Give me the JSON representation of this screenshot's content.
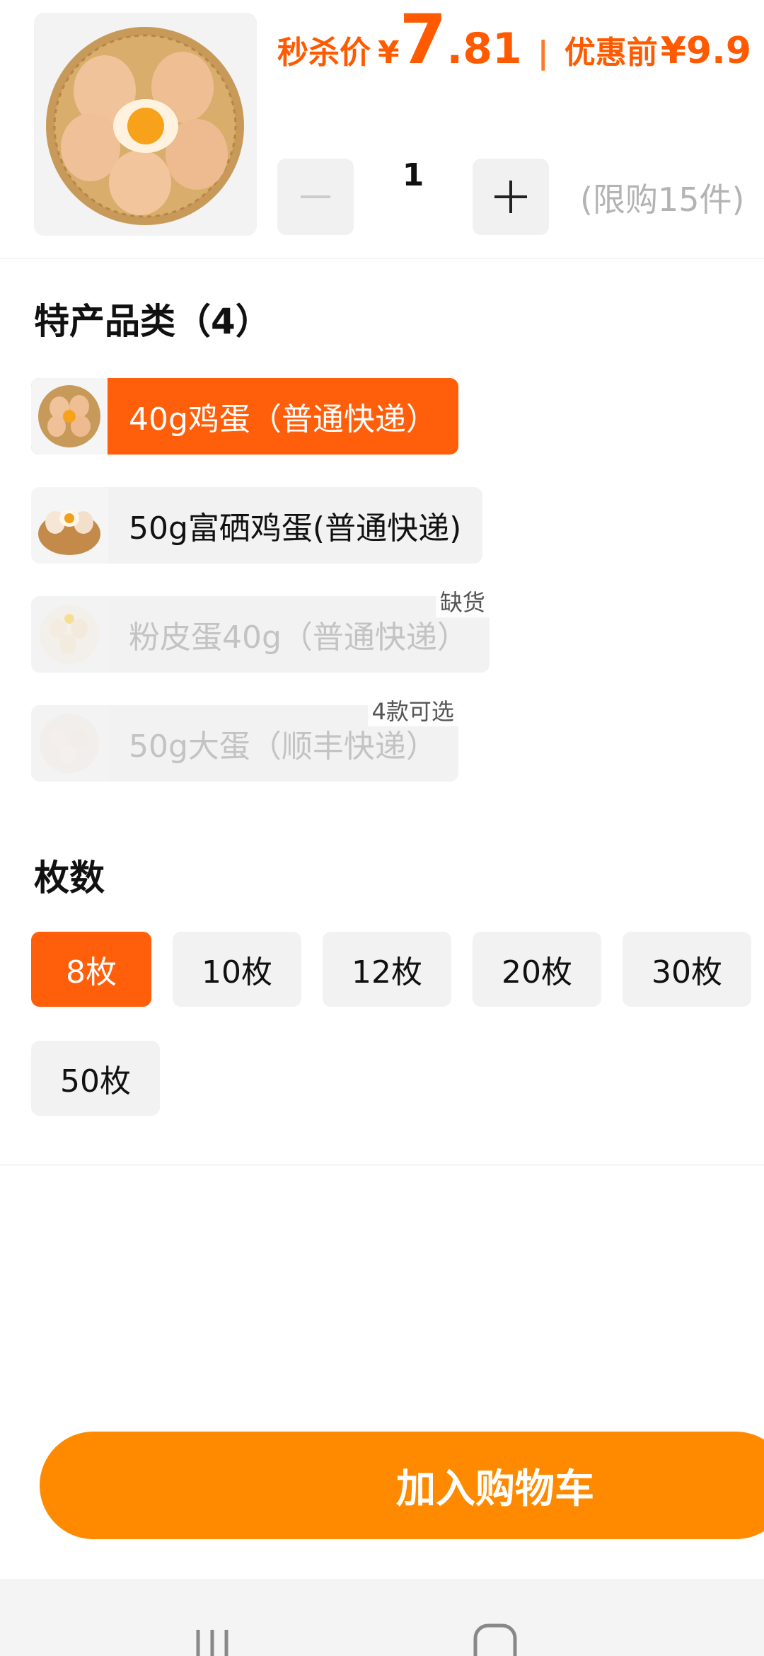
{
  "product": {
    "price_label": "秒杀价",
    "currency": "¥",
    "price_int": "7",
    "price_dec": ".81",
    "separator": "|",
    "orig_label": "优惠前",
    "orig_price": "¥9.9",
    "image_icon": "eggs-basket-image"
  },
  "quantity": {
    "value": "1",
    "limit_text": "(限购15件)"
  },
  "category": {
    "title": "特产品类（4）",
    "items": [
      {
        "label": "40g鸡蛋（普通快递）",
        "state": "selected",
        "badge": ""
      },
      {
        "label": "50g富硒鸡蛋(普通快递)",
        "state": "normal",
        "badge": ""
      },
      {
        "label": "粉皮蛋40g（普通快递）",
        "state": "disabled",
        "badge": "缺货"
      },
      {
        "label": "50g大蛋（顺丰快递）",
        "state": "disabled",
        "badge": "4款可选"
      }
    ]
  },
  "count": {
    "title": "枚数",
    "options": [
      "8枚",
      "10枚",
      "12枚",
      "20枚",
      "30枚",
      "50枚"
    ],
    "selected": "8枚"
  },
  "cart_button": "加入购物车",
  "colors": {
    "accent": "#ff5e0a",
    "cart": "#ff8a00",
    "price": "#ff5a00"
  }
}
